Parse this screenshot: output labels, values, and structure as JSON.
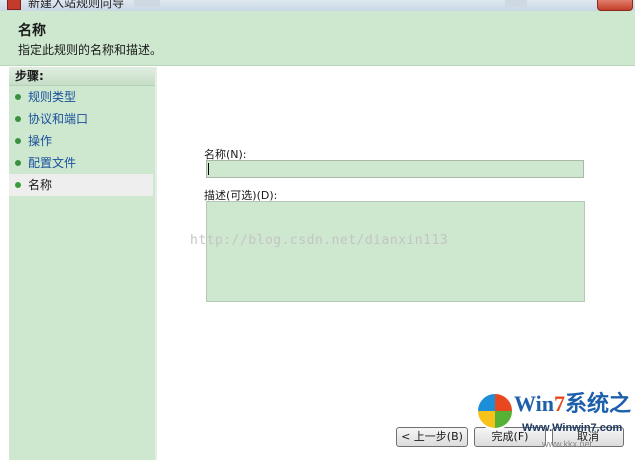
{
  "window": {
    "title": "新建入站规则向导"
  },
  "header": {
    "title": "名称",
    "description": "指定此规则的名称和描述。"
  },
  "steps": {
    "title": "步骤:",
    "items": [
      {
        "label": "规则类型"
      },
      {
        "label": "协议和端口"
      },
      {
        "label": "操作"
      },
      {
        "label": "配置文件"
      },
      {
        "label": "名称"
      }
    ]
  },
  "form": {
    "name_label": "名称(N):",
    "name_value": "",
    "description_label": "描述(可选)(D):",
    "description_value": ""
  },
  "watermark": "http://blog.csdn.net/dianxin113",
  "buttons": {
    "back": "< 上一步(B)",
    "finish": "完成(F)",
    "cancel": "取消"
  },
  "logo": {
    "win": "Win",
    "seven": "7",
    "brand": "系统之家",
    "url": "Www.Winwin7.com",
    "sub": "www.kkx.net"
  },
  "colors": {
    "header_bg": "#cde8cf",
    "input_bg": "#cde8cf",
    "link": "#1a4f9c"
  }
}
